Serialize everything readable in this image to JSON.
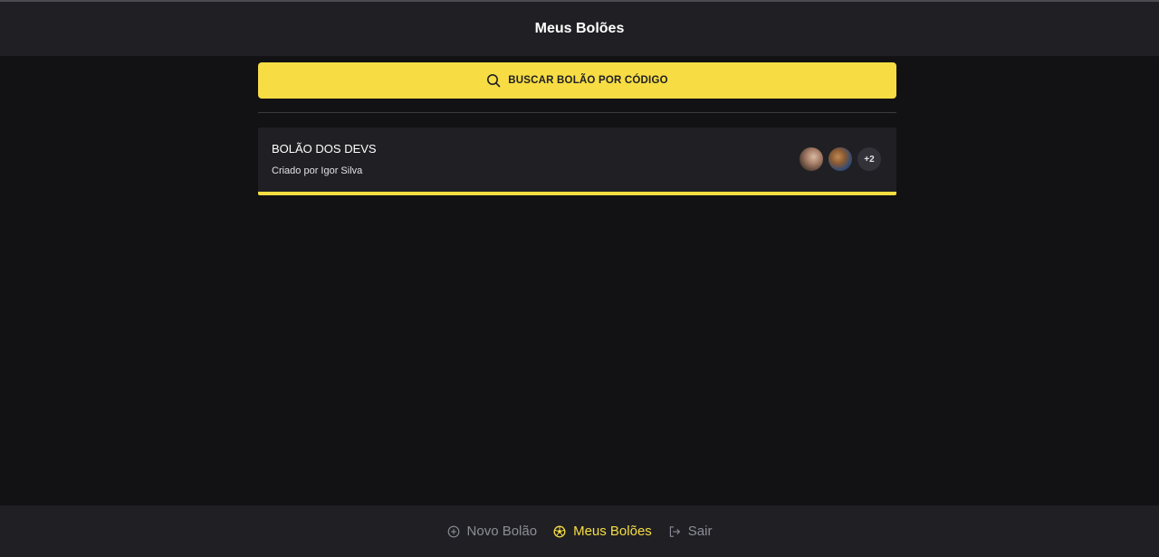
{
  "header": {
    "title": "Meus Bolões"
  },
  "search": {
    "label": "BUSCAR BOLÃO POR CÓDIGO",
    "icon": "search-icon"
  },
  "pools": [
    {
      "title": "BOLÃO DOS DEVS",
      "owner": "Criado por Igor Silva",
      "extra_participants": "+2"
    }
  ],
  "nav": {
    "new_pool": "Novo Bolão",
    "my_pools": "Meus Bolões",
    "logout": "Sair"
  },
  "colors": {
    "accent": "#f7dd43",
    "background": "#121214",
    "surface": "#202024",
    "muted_text": "#8d8d99"
  }
}
